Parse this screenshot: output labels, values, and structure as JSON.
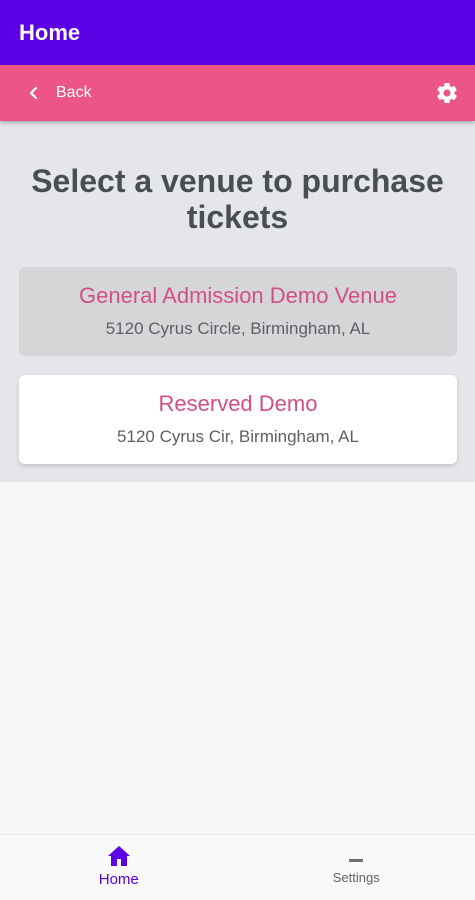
{
  "titlebar": {
    "title": "Home"
  },
  "subbar": {
    "back_label": "Back"
  },
  "main": {
    "heading": "Select a venue to purchase tickets",
    "venues": [
      {
        "name": "General Admission Demo Venue",
        "address": "5120 Cyrus Circle, Birmingham,  AL"
      },
      {
        "name": "Reserved Demo",
        "address": "5120 Cyrus Cir, Birmingham,  AL"
      }
    ]
  },
  "bottom_nav": {
    "items": [
      {
        "label": "Home",
        "icon": "home-icon"
      },
      {
        "label": "Settings",
        "icon": "settings-dash-icon"
      }
    ]
  },
  "colors": {
    "primary": "#5c00e6",
    "accent": "#ec5585",
    "venue_name": "#d14f86"
  }
}
